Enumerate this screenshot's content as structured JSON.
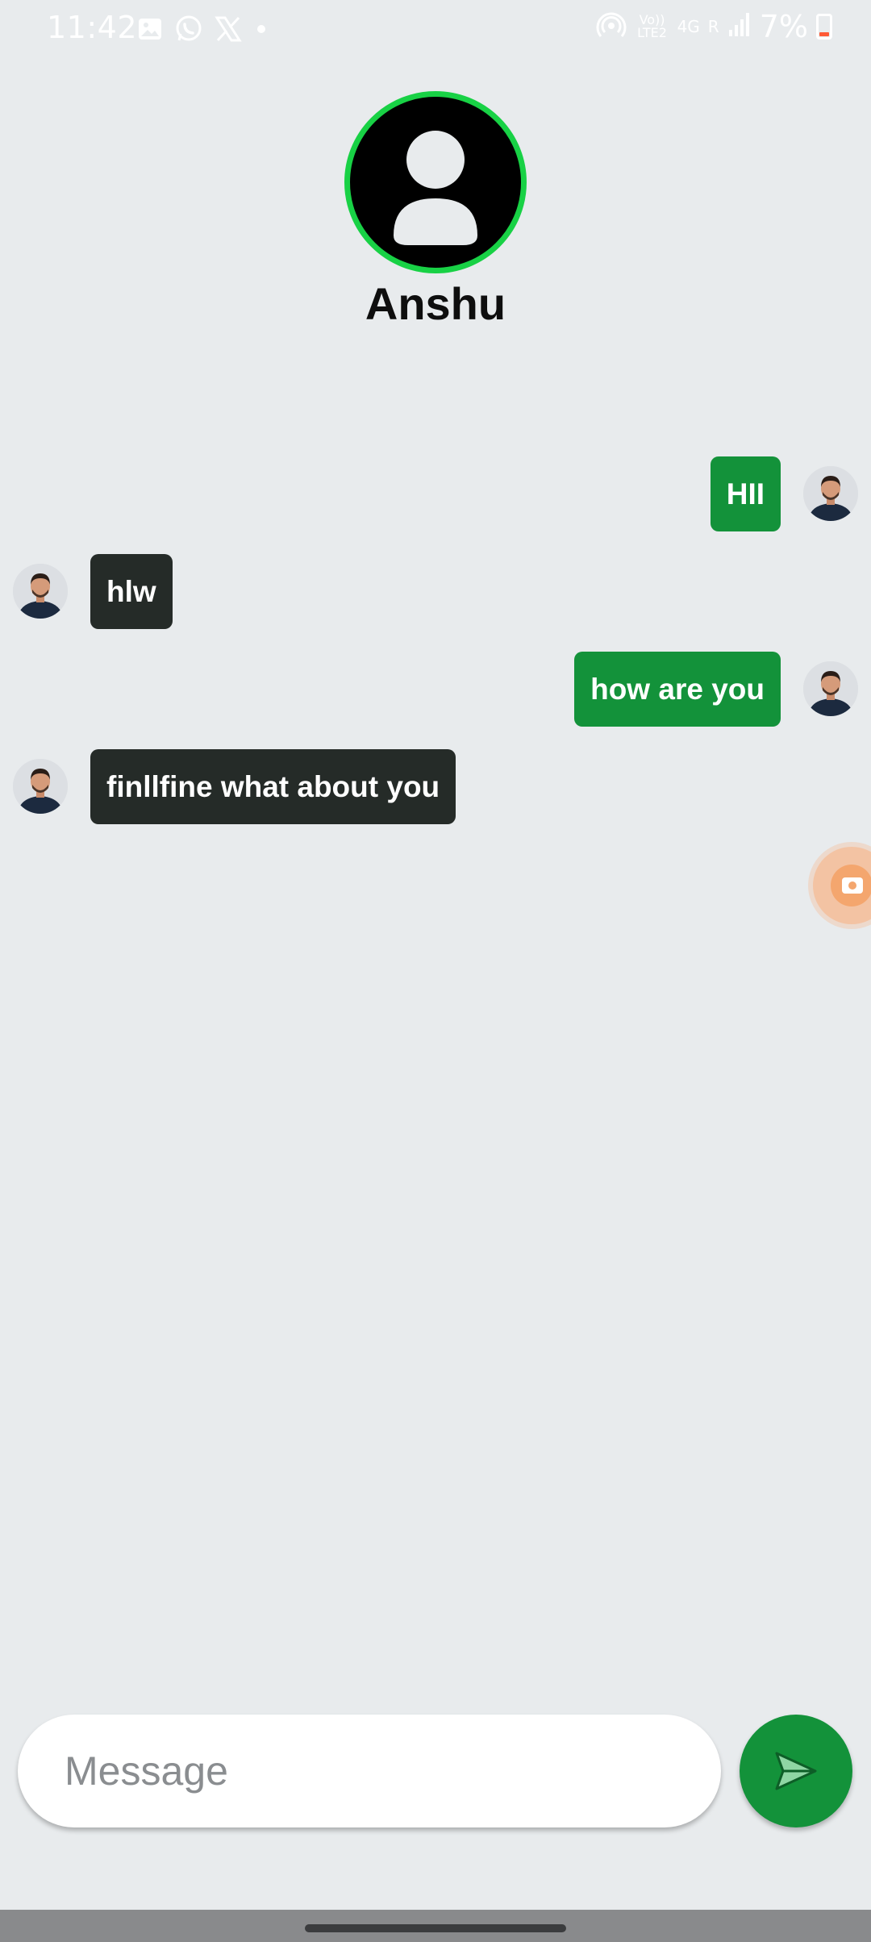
{
  "status_bar": {
    "time": "11:42",
    "volte_label": "Vo)) LTE2",
    "network_label": "4G",
    "roaming_label": "R",
    "battery_percent": "7%"
  },
  "header": {
    "contact_name": "Anshu",
    "avatar_ring_color": "#18d145"
  },
  "messages": [
    {
      "side": "sent",
      "text": "HII"
    },
    {
      "side": "received",
      "text": "hlw"
    },
    {
      "side": "sent",
      "text": "how are you"
    },
    {
      "side": "received",
      "text": "finllfine what about you"
    }
  ],
  "composer": {
    "placeholder": "Message",
    "value": ""
  },
  "colors": {
    "sent_bubble": "#13923a",
    "received_bubble": "#252b28",
    "background": "#e8ebed"
  },
  "icons": {
    "send": "send-icon",
    "record": "screen-record-icon"
  }
}
